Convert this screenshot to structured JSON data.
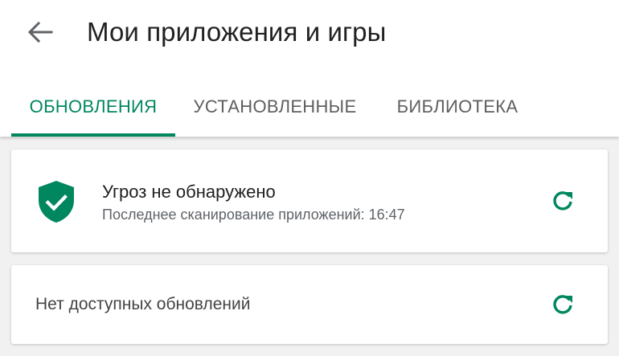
{
  "header": {
    "title": "Мои приложения и игры",
    "back_icon": "arrow-left-icon"
  },
  "tabs": [
    {
      "label": "ОБНОВЛЕНИЯ",
      "active": true
    },
    {
      "label": "УСТАНОВЛЕННЫЕ",
      "active": false
    },
    {
      "label": "БИБЛИОТЕКА",
      "active": false
    }
  ],
  "security_card": {
    "icon": "shield-check-icon",
    "title": "Угроз не обнаружено",
    "subtitle": "Последнее сканирование приложений: 16:47",
    "refresh_icon": "refresh-icon"
  },
  "updates_card": {
    "text": "Нет доступных обновлений",
    "refresh_icon": "refresh-icon"
  },
  "colors": {
    "accent": "#01875f",
    "title_text": "#212121",
    "secondary_text": "#5f6368",
    "inactive_tab": "#5f5f5f",
    "background": "#f1f1f1"
  }
}
